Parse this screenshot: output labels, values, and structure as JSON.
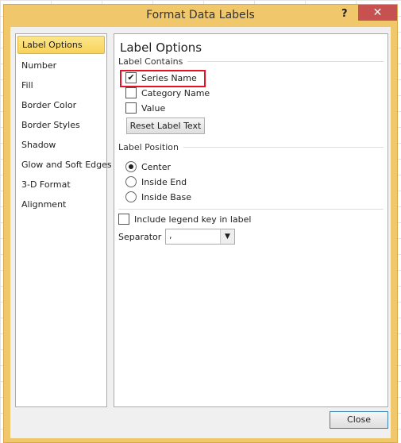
{
  "window": {
    "title": "Format Data Labels",
    "help": "?",
    "close": "✕"
  },
  "nav": {
    "items": [
      "Label Options",
      "Number",
      "Fill",
      "Border Color",
      "Border Styles",
      "Shadow",
      "Glow and Soft Edges",
      "3-D Format",
      "Alignment"
    ]
  },
  "main": {
    "heading": "Label Options",
    "label_contains": "Label Contains",
    "checks": [
      {
        "label": "Series Name",
        "checked": true
      },
      {
        "label": "Category Name",
        "checked": false
      },
      {
        "label": "Value",
        "checked": false
      }
    ],
    "reset": "Reset Label Text",
    "label_position": "Label Position",
    "positions": [
      {
        "label": "Center",
        "selected": true
      },
      {
        "label": "Inside End",
        "selected": false
      },
      {
        "label": "Inside Base",
        "selected": false
      }
    ],
    "legend_key": "Include legend key in label",
    "separator_label": "Separator",
    "separator_value": ","
  },
  "footer": {
    "close": "Close"
  },
  "colors": {
    "highlight": "#e81123"
  }
}
